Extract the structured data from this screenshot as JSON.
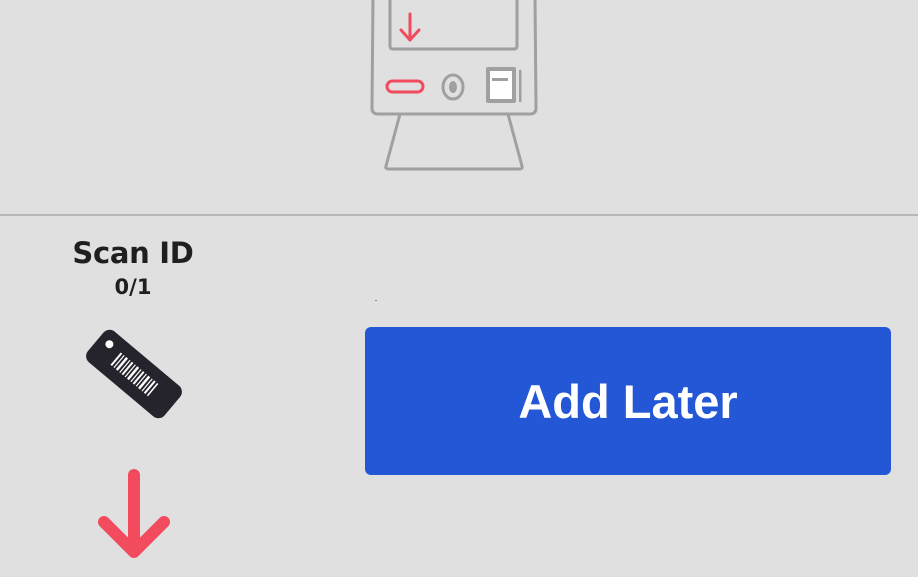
{
  "scan": {
    "title": "Scan ID",
    "count": "0/1"
  },
  "actions": {
    "add_later_label": "Add Later"
  },
  "icons": {
    "kiosk": "kiosk-icon",
    "tag": "barcode-tag-icon",
    "arrow": "arrow-down-icon"
  },
  "colors": {
    "background": "#e0e0e0",
    "accent_red": "#f24b5e",
    "button_blue": "#2457d6",
    "outline_gray": "#a0a0a0",
    "tag_dark": "#25242c"
  }
}
